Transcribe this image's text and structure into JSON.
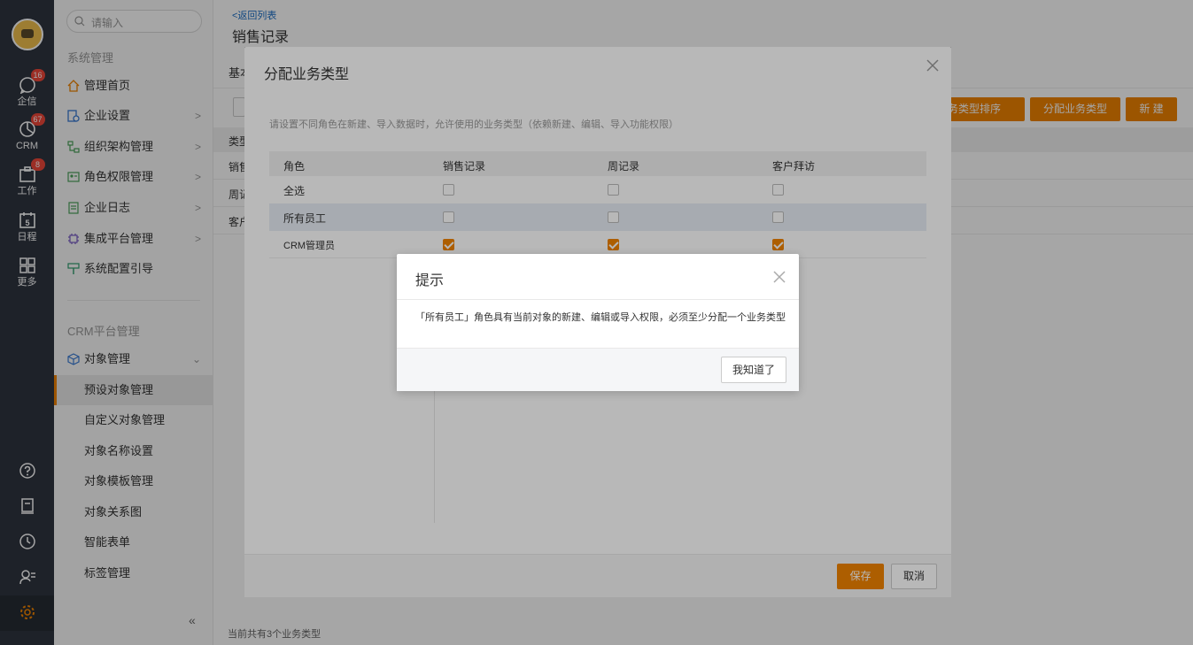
{
  "rail": {
    "items": [
      {
        "label": "企信",
        "badge": "16",
        "icon": "chat-icon"
      },
      {
        "label": "CRM",
        "badge": "67",
        "icon": "crm-icon"
      },
      {
        "label": "工作",
        "badge": "8",
        "icon": "work-icon"
      },
      {
        "label": "日程",
        "badge": "",
        "icon": "calendar-icon",
        "day": "5"
      },
      {
        "label": "更多",
        "badge": "",
        "icon": "grid-icon"
      }
    ]
  },
  "sidebar": {
    "search_placeholder": "请输入",
    "section1": "系统管理",
    "items": [
      {
        "label": "管理首页",
        "icon": "home-icon"
      },
      {
        "label": "企业设置",
        "icon": "enterprise-settings-icon"
      },
      {
        "label": "组织架构管理",
        "icon": "org-chart-icon"
      },
      {
        "label": "角色权限管理",
        "icon": "role-permission-icon"
      },
      {
        "label": "企业日志",
        "icon": "log-icon"
      },
      {
        "label": "集成平台管理",
        "icon": "integration-icon"
      },
      {
        "label": "系统配置引导",
        "icon": "guide-icon"
      }
    ],
    "section2": "CRM平台管理",
    "object_mgmt": "对象管理",
    "sub_items": [
      "预设对象管理",
      "自定义对象管理",
      "对象名称设置",
      "对象模板管理",
      "对象关系图",
      "智能表单",
      "标签管理"
    ],
    "collapse": "«"
  },
  "main": {
    "back_link": "<返回列表",
    "title": "销售记录",
    "tab_basic": "基本",
    "buttons": {
      "sort": "业务类型排序",
      "assign": "分配业务类型",
      "new": "新 建"
    },
    "table_head": "类型",
    "rows": [
      "销售",
      "周记",
      "客户"
    ],
    "footer": "当前共有3个业务类型"
  },
  "dialog": {
    "title": "分配业务类型",
    "hint": "请设置不同角色在新建、导入数据时，允许使用的业务类型（依赖新建、编辑、导入功能权限）",
    "columns": [
      "角色",
      "销售记录",
      "周记录",
      "客户拜访"
    ],
    "rows": [
      {
        "role": "全选",
        "checks": [
          false,
          false,
          false
        ]
      },
      {
        "role": "所有员工",
        "checks": [
          false,
          false,
          false
        ]
      },
      {
        "role": "CRM管理员",
        "checks": [
          true,
          true,
          true
        ]
      }
    ],
    "save": "保存",
    "cancel": "取消"
  },
  "alert": {
    "title": "提示",
    "message": "「所有员工」角色具有当前对象的新建、编辑或导入权限，必须至少分配一个业务类型",
    "ok": "我知道了"
  },
  "colors": {
    "accent": "#f08300",
    "rail": "#2f3540",
    "link": "#1a6ec7"
  }
}
